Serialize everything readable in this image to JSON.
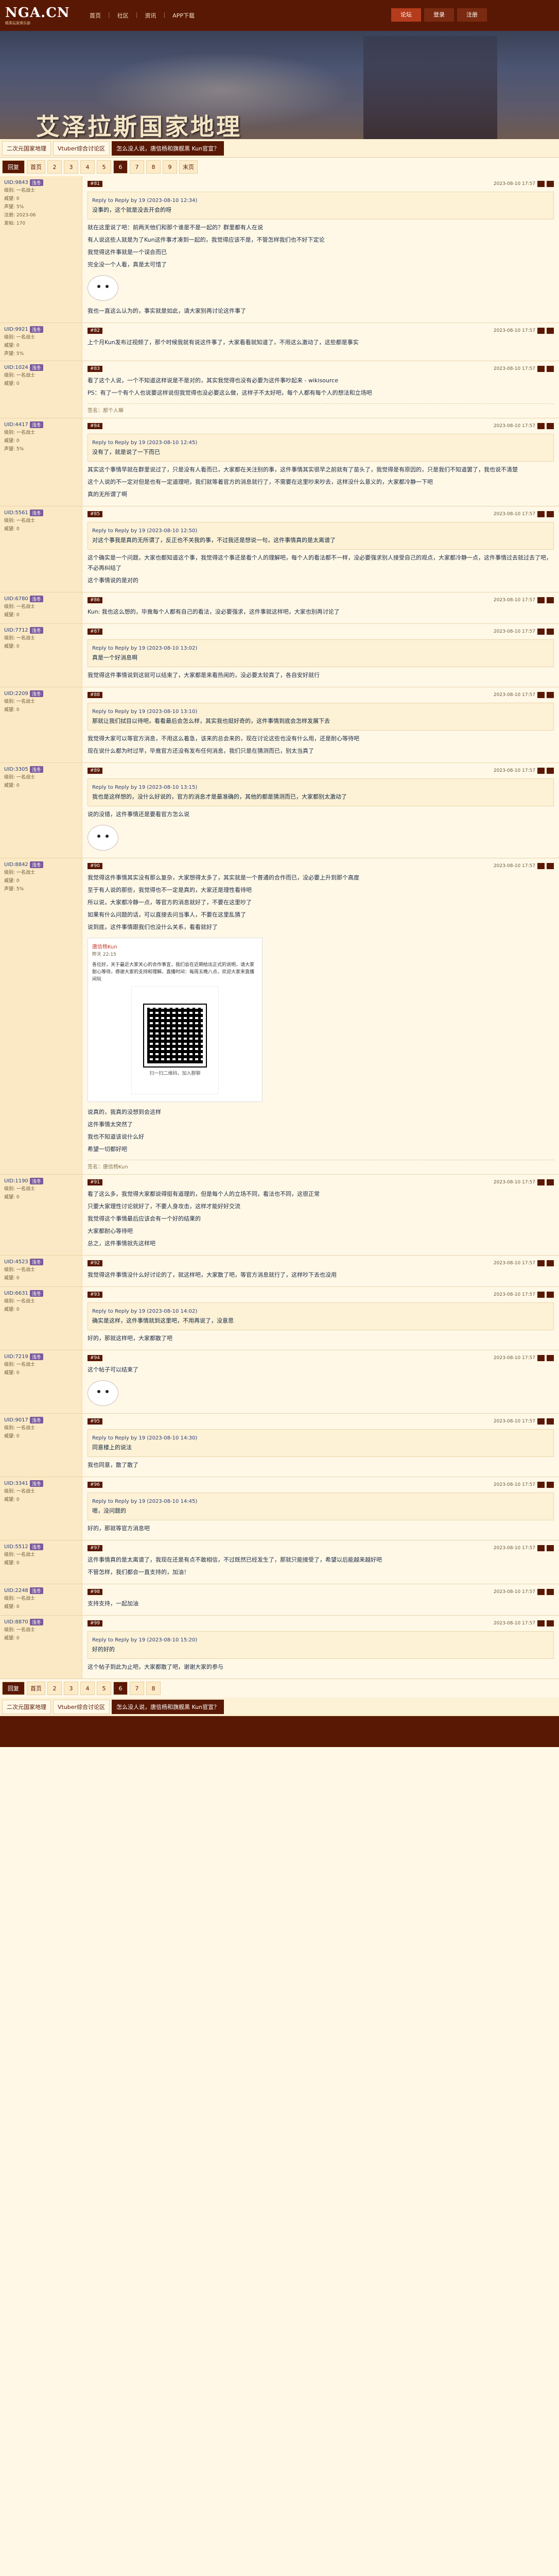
{
  "site": {
    "logo": "NGA.CN",
    "logo_sub": "精英玩家俱乐部"
  },
  "topnav": [
    "首页",
    "社区",
    "资讯",
    "APP下载"
  ],
  "topright": [
    "论坛",
    "登录",
    "注册"
  ],
  "banner_title": "艾泽拉斯国家地理",
  "breadcrumbs": [
    "二次元国家地理",
    "Vtuber综合讨论区",
    "怎么没人说，唐信杨和旗舰黑 Kun官宣？"
  ],
  "pager": {
    "label": "回复",
    "pages": [
      "首页",
      "2",
      "3",
      "4",
      "5",
      "6",
      "7",
      "8",
      "9",
      "末页"
    ],
    "current": "6"
  },
  "posts": [
    {
      "floor": "#81",
      "user": "UID:9843",
      "lvl": "浅冬",
      "time": "2023-08-10 17:57",
      "meta": [
        "级别: 一名战士",
        "威望: 0",
        "声望: 5%",
        "注册: 2023-06",
        "发帖: 170"
      ],
      "quote_head": "Reply to Reply by 19 (2023-08-10 12:34)",
      "quote": "没事的，这个就是没去开会的呀",
      "body": [
        "就在这里说了吧：前两天他们和那个谁是不是一起的？群里都有人在说",
        "有人说这些人就是为了Kun这件事才凑到一起的，我觉得应该不是，不管怎样我们也不好下定论",
        "我觉得这件事就是一个误会而已",
        "完全没一个人看，真是太可惜了"
      ],
      "tail": "我也一直这么认为的，事实就是如此，请大家别再讨论这件事了"
    },
    {
      "floor": "#82",
      "user": "UID:9921",
      "lvl": "浅冬",
      "time": "2023-08-10 17:57",
      "meta": [
        "级别: 一名战士",
        "威望: 0",
        "声望: 5%"
      ],
      "body": [
        "上个月Kun发布过视频了，那个时候我就有说这件事了，大家看看就知道了，不用这么激动了，这些都是事实"
      ]
    },
    {
      "floor": "#83",
      "user": "UID:1024",
      "lvl": "浅冬",
      "time": "2023-08-10 17:57",
      "meta": [
        "级别: 一名战士",
        "威望: 0"
      ],
      "body": [
        "看了这个人说，一个不知道这样说是不是对的，其实我觉得也没有必要为这件事吵起来 - wikisource",
        "PS：有了一个有个人也说要这样说但我觉得也没必要这么做，这样子不太好吧，每个人都有每个人的想法和立场吧"
      ],
      "sig": "签名：那个人嘛"
    },
    {
      "floor": "#84",
      "user": "UID:4417",
      "lvl": "浅冬",
      "time": "2023-08-10 17:57",
      "meta": [
        "级别: 一名战士",
        "威望: 0",
        "声望: 5%"
      ],
      "body": [
        "其实这个事情早就在群里说过了，只是没有人看而已，大家都在关注别的事，这件事情其实很早之前就有了苗头了，我觉得是有原因的，只是我们不知道罢了，我也说不清楚",
        "这个人说的不一定对但是也有一定道理吧，我们就等着官方的消息就行了，不需要在这里吵来吵去，这样没什么意义的，大家都冷静一下吧"
      ],
      "quote_head": "Reply to Reply by 19 (2023-08-10 12:45)",
      "quote": "没有了，就是说了一下而已",
      "tail": "真的无所谓了啊"
    },
    {
      "floor": "#85",
      "user": "UID:5561",
      "lvl": "浅冬",
      "time": "2023-08-10 17:57",
      "meta": [
        "级别: 一名战士",
        "威望: 0"
      ],
      "body": [
        "这个确实是一个问题，大家也都知道这个事，我觉得这个事还是看个人的理解吧，每个人的看法都不一样，没必要强求别人接受自己的观点，大家都冷静一点，这件事情过去就过去了吧，不必再纠结了"
      ],
      "quote_head": "Reply to Reply by 19 (2023-08-10 12:50)",
      "quote": "对这个事我是真的无所谓了，反正也不关我的事，不过我还是想说一句，这件事情真的是太离谱了",
      "tail": "这个事情说的是对的"
    },
    {
      "floor": "#86",
      "user": "UID:6780",
      "lvl": "浅冬",
      "time": "2023-08-10 17:57",
      "meta": [
        "级别: 一名战士",
        "威望: 0"
      ],
      "body": [
        "Kun: 我也这么想的，毕竟每个人都有自己的看法，没必要强求，这件事就这样吧，大家也别再讨论了"
      ]
    },
    {
      "floor": "#87",
      "user": "UID:7712",
      "lvl": "浅冬",
      "time": "2023-08-10 17:57",
      "meta": [
        "级别: 一名战士",
        "威望: 0"
      ],
      "quote_head": "Reply to Reply by 19 (2023-08-10 13:02)",
      "quote": "真是一个好消息啊",
      "body": [
        "我觉得这件事情说到这就可以结束了，大家都是来看热闹的，没必要太较真了，各自安好就行"
      ]
    },
    {
      "floor": "#88",
      "user": "UID:2209",
      "lvl": "浅冬",
      "time": "2023-08-10 17:57",
      "meta": [
        "级别: 一名战士",
        "威望: 0"
      ],
      "quote_head": "Reply to Reply by 19 (2023-08-10 13:10)",
      "quote": "那就让我们拭目以待吧，看看最后会怎么样，其实我也挺好奇的，这件事情到底会怎样发展下去",
      "body": [
        "我觉得大家可以等官方消息，不用这么着急，该来的总会来的，现在讨论这些也没有什么用，还是耐心等待吧",
        "现在说什么都为时过早，毕竟官方还没有发布任何消息，我们只是在猜测而已，别太当真了"
      ]
    },
    {
      "floor": "#89",
      "user": "UID:3305",
      "lvl": "浅冬",
      "time": "2023-08-10 17:57",
      "meta": [
        "级别: 一名战士",
        "威望: 0"
      ],
      "quote_head": "Reply to Reply by 19 (2023-08-10 13:15)",
      "quote": "我也是这样想的，没什么好说的，官方的消息才是最准确的，其他的都是猜测而已，大家都别太激动了",
      "body": [
        "说的没错，这件事情还是要看官方怎么说"
      ]
    },
    {
      "floor": "#90",
      "user": "UID:8842",
      "lvl": "浅冬",
      "time": "2023-08-10 17:57",
      "meta": [
        "级别: 一名战士",
        "威望: 0",
        "声望: 5%"
      ],
      "body": [
        "我觉得这件事情其实没有那么复杂，大家想得太多了，其实就是一个普通的合作而已，没必要上升到那个高度",
        "至于有人说的那些，我觉得也不一定是真的，大家还是理性看待吧",
        "所以说，大家都冷静一点，等官方的消息就好了，不要在这里吵了",
        "如果有什么问题的话，可以直接去问当事人，不要在这里乱猜了",
        "说到底，这件事情跟我们也没什么关系，看看就好了"
      ],
      "card": {
        "name": "唐信杨Kun",
        "time": "昨天 22:15",
        "text": "各位好，关于最近大家关心的合作事宜，我们会在近期给出正式的说明，请大家耐心等待，感谢大家的支持和理解。直播时间：每周五晚八点，欢迎大家来直播间玩",
        "qr_caption": "扫一扫二维码，加入群聊"
      },
      "tail": [
        "说真的，我真的没想到会这样",
        "这件事情太突然了",
        "我也不知道该说什么好",
        "希望一切都好吧"
      ],
      "sig": "签名：唐信杨Kun"
    },
    {
      "floor": "#91",
      "user": "UID:1190",
      "lvl": "浅冬",
      "time": "2023-08-10 17:57",
      "meta": [
        "级别: 一名战士",
        "威望: 0"
      ],
      "body": [
        "看了这么多，我觉得大家都说得挺有道理的，但是每个人的立场不同，看法也不同，这很正常",
        "只要大家理性讨论就好了，不要人身攻击，这样才能好好交流",
        "我觉得这个事情最后应该会有一个好的结果的",
        "大家都耐心等待吧",
        "总之，这件事情就先这样吧"
      ]
    },
    {
      "floor": "#92",
      "user": "UID:4523",
      "lvl": "浅冬",
      "time": "2023-08-10 17:57",
      "meta": [
        "级别: 一名战士",
        "威望: 0"
      ],
      "body": [
        "我觉得这件事情没什么好讨论的了，就这样吧，大家散了吧，等官方消息就行了，这样吵下去也没用"
      ]
    },
    {
      "floor": "#93",
      "user": "UID:6631",
      "lvl": "浅冬",
      "time": "2023-08-10 17:57",
      "meta": [
        "级别: 一名战士",
        "威望: 0"
      ],
      "quote_head": "Reply to Reply by 19 (2023-08-10 14:02)",
      "quote": "确实是这样，这件事情就到这里吧，不用再说了，没意思",
      "body": [
        "好的，那就这样吧，大家都散了吧"
      ]
    },
    {
      "floor": "#94",
      "user": "UID:7219",
      "lvl": "浅冬",
      "time": "2023-08-10 17:57",
      "meta": [
        "级别: 一名战士",
        "威望: 0"
      ],
      "body": [
        "这个帖子可以结束了"
      ]
    },
    {
      "floor": "#95",
      "user": "UID:9017",
      "lvl": "浅冬",
      "time": "2023-08-10 17:57",
      "meta": [
        "级别: 一名战士",
        "威望: 0"
      ],
      "quote_head": "Reply to Reply by 19 (2023-08-10 14:30)",
      "quote": "同意楼上的说法",
      "body": [
        "我也同意，散了散了"
      ]
    },
    {
      "floor": "#96",
      "user": "UID:3341",
      "lvl": "浅冬",
      "time": "2023-08-10 17:57",
      "meta": [
        "级别: 一名战士",
        "威望: 0"
      ],
      "quote_head": "Reply to Reply by 19 (2023-08-10 14:45)",
      "quote": "嗯，没问题的",
      "body": [
        "好的，那就等官方消息吧"
      ]
    },
    {
      "floor": "#97",
      "user": "UID:5512",
      "lvl": "浅冬",
      "time": "2023-08-10 17:57",
      "meta": [
        "级别: 一名战士",
        "威望: 0"
      ],
      "body": [
        "这件事情真的是太离谱了，我现在还是有点不敢相信，不过既然已经发生了，那就只能接受了，希望以后能越来越好吧",
        "不管怎样，我们都会一直支持的，加油！"
      ]
    },
    {
      "floor": "#98",
      "user": "UID:2248",
      "lvl": "浅冬",
      "time": "2023-08-10 17:57",
      "meta": [
        "级别: 一名战士",
        "威望: 0"
      ],
      "body": [
        "支持支持，一起加油"
      ]
    },
    {
      "floor": "#99",
      "user": "UID:8870",
      "lvl": "浅冬",
      "time": "2023-08-10 17:57",
      "meta": [
        "级别: 一名战士",
        "威望: 0"
      ],
      "quote_head": "Reply to Reply by 19 (2023-08-10 15:20)",
      "quote": "好的好的",
      "body": [
        "这个帖子到此为止吧，大家都散了吧，谢谢大家的参与"
      ]
    }
  ],
  "reply_label": "回复"
}
